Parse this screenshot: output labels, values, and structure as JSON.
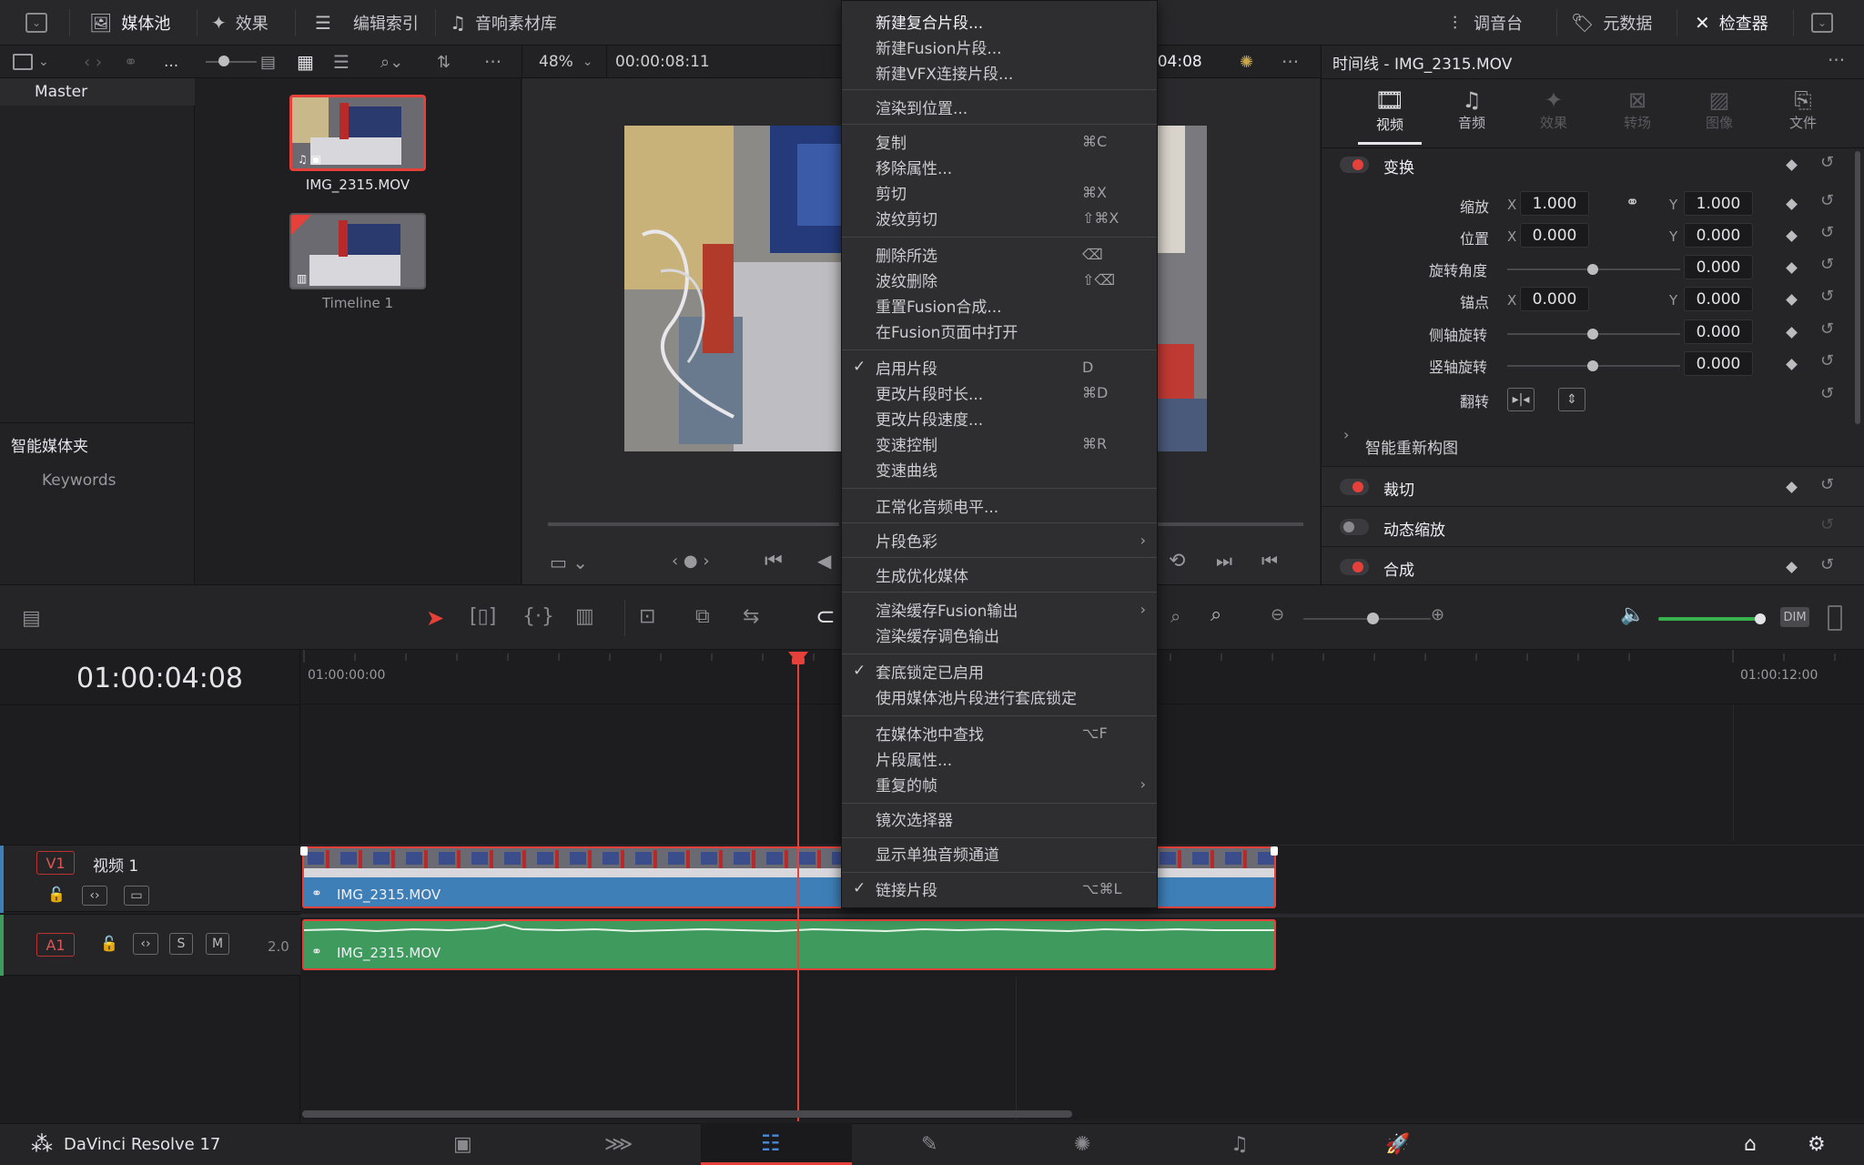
{
  "topbar": {
    "media_pool": "媒体池",
    "effects": "效果",
    "edit_index": "编辑索引",
    "sound_library": "音响素材库",
    "mixer": "调音台",
    "metadata": "元数据",
    "inspector": "检查器"
  },
  "viewer_bar": {
    "zoom": "48%",
    "timecode": "00:00:08:11",
    "right_timecode": ":04:08",
    "more": "..."
  },
  "bins": {
    "master": "Master",
    "smart_bins": "智能媒体夹",
    "keywords": "Keywords"
  },
  "media_pool": {
    "clips": [
      {
        "name": "IMG_2315.MOV"
      },
      {
        "name": "Timeline 1"
      }
    ]
  },
  "inspector": {
    "title": "时间线 - IMG_2315.MOV",
    "tabs": [
      {
        "label": "视频",
        "icon": "film-icon"
      },
      {
        "label": "音频",
        "icon": "music-note-icon"
      },
      {
        "label": "效果",
        "icon": "magic-wand-icon"
      },
      {
        "label": "转场",
        "icon": "transition-icon"
      },
      {
        "label": "图像",
        "icon": "image-icon"
      },
      {
        "label": "文件",
        "icon": "file-icon"
      }
    ],
    "transform": {
      "header": "变换",
      "zoom_label": "缩放",
      "zoom_x": "1.000",
      "zoom_y": "1.000",
      "position_label": "位置",
      "position_x": "0.000",
      "position_y": "0.000",
      "rotation_label": "旋转角度",
      "rotation": "0.000",
      "anchor_label": "锚点",
      "anchor_x": "0.000",
      "anchor_y": "0.000",
      "pitch_label": "侧轴旋转",
      "pitch": "0.000",
      "yaw_label": "竖轴旋转",
      "yaw": "0.000",
      "flip_label": "翻转",
      "x": "X",
      "y": "Y"
    },
    "smart_reframe": "智能重新构图",
    "crop": "裁切",
    "dynamic_zoom": "动态缩放",
    "composite": "合成"
  },
  "context_menu": {
    "items": [
      {
        "label": "新建复合片段...",
        "shortcut": "",
        "check": false,
        "arrow": false,
        "highlight": true
      },
      {
        "label": "新建Fusion片段...",
        "shortcut": "",
        "check": false,
        "arrow": false
      },
      {
        "label": "新建VFX连接片段...",
        "shortcut": "",
        "check": false,
        "arrow": false
      },
      {
        "label": "渲染到位置...",
        "shortcut": "",
        "check": false,
        "arrow": false
      },
      {
        "label": "复制",
        "shortcut": "⌘C",
        "check": false,
        "arrow": false
      },
      {
        "label": "移除属性...",
        "shortcut": "",
        "check": false,
        "arrow": false
      },
      {
        "label": "剪切",
        "shortcut": "⌘X",
        "check": false,
        "arrow": false
      },
      {
        "label": "波纹剪切",
        "shortcut": "⇧⌘X",
        "check": false,
        "arrow": false
      },
      {
        "label": "删除所选",
        "shortcut": "⌫",
        "check": false,
        "arrow": false
      },
      {
        "label": "波纹删除",
        "shortcut": "⇧⌫",
        "check": false,
        "arrow": false
      },
      {
        "label": "重置Fusion合成...",
        "shortcut": "",
        "check": false,
        "arrow": false
      },
      {
        "label": "在Fusion页面中打开",
        "shortcut": "",
        "check": false,
        "arrow": false
      },
      {
        "label": "启用片段",
        "shortcut": "D",
        "check": true,
        "arrow": false
      },
      {
        "label": "更改片段时长...",
        "shortcut": "⌘D",
        "check": false,
        "arrow": false
      },
      {
        "label": "更改片段速度...",
        "shortcut": "",
        "check": false,
        "arrow": false
      },
      {
        "label": "变速控制",
        "shortcut": "⌘R",
        "check": false,
        "arrow": false
      },
      {
        "label": "变速曲线",
        "shortcut": "",
        "check": false,
        "arrow": false
      },
      {
        "label": "正常化音频电平...",
        "shortcut": "",
        "check": false,
        "arrow": false
      },
      {
        "label": "片段色彩",
        "shortcut": "",
        "check": false,
        "arrow": true
      },
      {
        "label": "生成优化媒体",
        "shortcut": "",
        "check": false,
        "arrow": false
      },
      {
        "label": "渲染缓存Fusion输出",
        "shortcut": "",
        "check": false,
        "arrow": true
      },
      {
        "label": "渲染缓存调色输出",
        "shortcut": "",
        "check": false,
        "arrow": false
      },
      {
        "label": "套底锁定已启用",
        "shortcut": "",
        "check": true,
        "arrow": false
      },
      {
        "label": "使用媒体池片段进行套底锁定",
        "shortcut": "",
        "check": false,
        "arrow": false
      },
      {
        "label": "在媒体池中查找",
        "shortcut": "⌥F",
        "check": false,
        "arrow": false
      },
      {
        "label": "片段属性...",
        "shortcut": "",
        "check": false,
        "arrow": false
      },
      {
        "label": "重复的帧",
        "shortcut": "",
        "check": false,
        "arrow": true
      },
      {
        "label": "镜次选择器",
        "shortcut": "",
        "check": false,
        "arrow": false
      },
      {
        "label": "显示单独音频通道",
        "shortcut": "",
        "check": false,
        "arrow": false
      },
      {
        "label": "链接片段",
        "shortcut": "⌥⌘L",
        "check": true,
        "arrow": false
      }
    ]
  },
  "timeline": {
    "current_timecode": "01:00:04:08",
    "ruler_start": "01:00:00:00",
    "ruler_end": "01:00:12:00",
    "dim_label": "DIM",
    "video_track": {
      "label": "V1",
      "name": "视频 1",
      "clip": "IMG_2315.MOV"
    },
    "audio_track": {
      "label": "A1",
      "solo": "S",
      "mute": "M",
      "channels": "2.0",
      "clip": "IMG_2315.MOV"
    }
  },
  "bottombar": {
    "app_name": "DaVinci Resolve 17"
  },
  "colors": {
    "accent_red": "#e5413a",
    "video_clip": "#3f7fb8",
    "audio_clip": "#3f9a5e",
    "volume_green": "#36b14c"
  }
}
